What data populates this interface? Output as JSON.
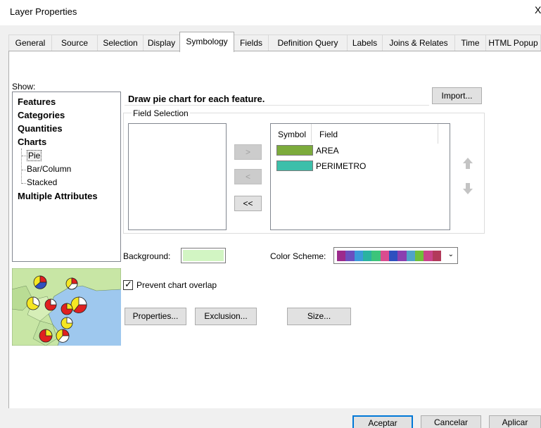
{
  "window": {
    "title": "Layer Properties",
    "close_glyph": "X"
  },
  "tabs": [
    {
      "label": "General"
    },
    {
      "label": "Source"
    },
    {
      "label": "Selection"
    },
    {
      "label": "Display"
    },
    {
      "label": "Symbology"
    },
    {
      "label": "Fields"
    },
    {
      "label": "Definition Query"
    },
    {
      "label": "Labels"
    },
    {
      "label": "Joins & Relates"
    },
    {
      "label": "Time"
    },
    {
      "label": "HTML Popup"
    }
  ],
  "active_tab": "Symbology",
  "show": {
    "label": "Show:",
    "items": [
      {
        "label": "Features"
      },
      {
        "label": "Categories"
      },
      {
        "label": "Quantities"
      },
      {
        "label": "Charts"
      },
      {
        "label": "Pie"
      },
      {
        "label": "Bar/Column"
      },
      {
        "label": "Stacked"
      },
      {
        "label": "Multiple Attributes"
      }
    ],
    "selected": "Pie"
  },
  "description": "Draw pie chart for each feature.",
  "import_label": "Import...",
  "field_selection": {
    "label": "Field Selection",
    "col_symbol": "Symbol",
    "col_field": "Field",
    "rows": [
      {
        "field": "AREA",
        "color": "#7cab3c"
      },
      {
        "field": "PERIMETRO",
        "color": "#3cbfaa"
      }
    ]
  },
  "move_buttons": {
    "add": ">",
    "remove": "<",
    "remove_all": "<<"
  },
  "background": {
    "label": "Background:",
    "color": "#d2f5c3"
  },
  "color_scheme": {
    "label": "Color  Scheme:",
    "colors": [
      "#9c2a8c",
      "#6b4fbf",
      "#3b9ad9",
      "#2ab3a0",
      "#3cc47a",
      "#d94c8f",
      "#2e4fbf",
      "#8a3fb0",
      "#4fa3c8",
      "#6fbf3a",
      "#c8438a",
      "#b23a5a"
    ]
  },
  "prevent_overlap": {
    "label": "Prevent chart overlap",
    "checked": true
  },
  "buttons": {
    "properties": "Properties...",
    "exclusion": "Exclusion...",
    "size": "Size...",
    "ok": "Aceptar",
    "cancel": "Cancelar",
    "apply": "Aplicar"
  },
  "colors": {
    "accent": "#0078d7",
    "map_water": "#9ec8ee",
    "map_land": "#c8e6a5"
  }
}
